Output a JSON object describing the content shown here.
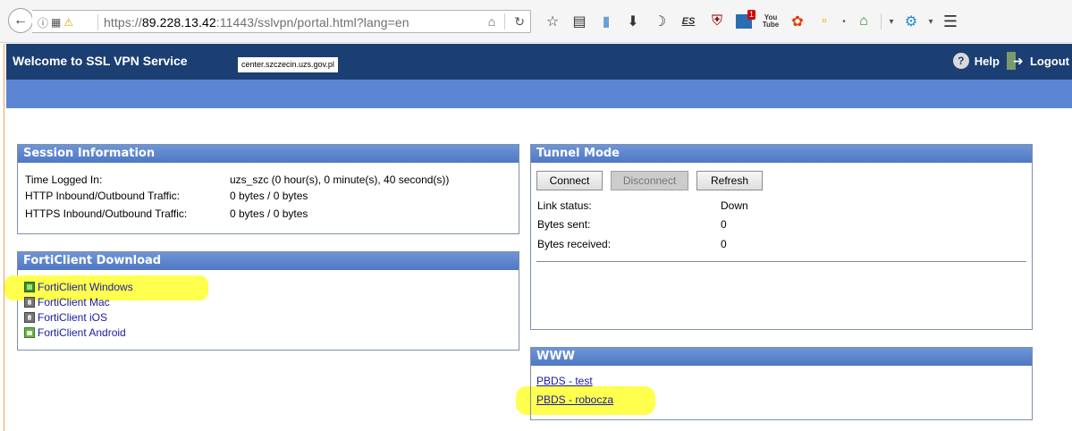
{
  "browser": {
    "url_prefix": "https://",
    "url_host": "89.228.13.42",
    "url_rest": ":11443/sslvpn/portal.html?lang=en",
    "toolbar_es": "ES"
  },
  "header": {
    "title": "Welcome to SSL VPN Service",
    "host_label": "center.szczecin.uzs.gov.pl",
    "help": "Help",
    "logout": "Logout"
  },
  "session": {
    "title": "Session Information",
    "rows": [
      {
        "label": "Time Logged In:",
        "value": "uzs_szc (0 hour(s), 0 minute(s), 40 second(s))"
      },
      {
        "label": "HTTP Inbound/Outbound Traffic:",
        "value": "0 bytes / 0 bytes"
      },
      {
        "label": "HTTPS Inbound/Outbound Traffic:",
        "value": "0 bytes / 0 bytes"
      }
    ]
  },
  "download": {
    "title": "FortiClient Download",
    "items": [
      {
        "label": "FortiClient Windows",
        "icon": "windows-icon"
      },
      {
        "label": "FortiClient Mac",
        "icon": "apple-icon"
      },
      {
        "label": "FortiClient iOS",
        "icon": "apple-icon"
      },
      {
        "label": "FortiClient Android",
        "icon": "android-icon"
      }
    ]
  },
  "tunnel": {
    "title": "Tunnel Mode",
    "connect": "Connect",
    "disconnect": "Disconnect",
    "refresh": "Refresh",
    "rows": [
      {
        "label": "Link status:",
        "value": "Down"
      },
      {
        "label": "Bytes sent:",
        "value": "0"
      },
      {
        "label": "Bytes received:",
        "value": "0"
      }
    ]
  },
  "www": {
    "title": "WWW",
    "links": [
      "PBDS - test",
      "PBDS - robocza"
    ]
  },
  "colors": {
    "header_bg": "#1c3f73",
    "bar_bg": "#5c86d4",
    "panel_head": "#5b83cc",
    "highlight": "#ffff4d",
    "link": "#1a1aa6"
  }
}
